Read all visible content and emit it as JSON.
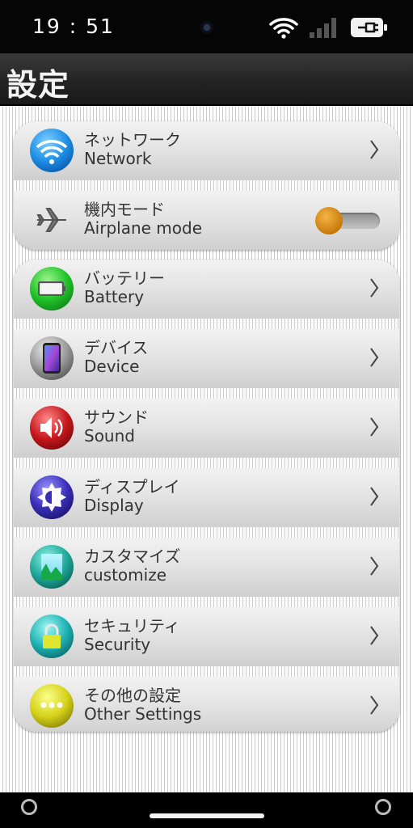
{
  "status_bar": {
    "time": "19 : 51",
    "icons": [
      "wifi-icon",
      "signal-icon",
      "battery-charging-icon"
    ]
  },
  "header": {
    "title": "設定"
  },
  "settings": {
    "network": {
      "ja": "ネットワーク",
      "en": "Network",
      "icon": "wifi-icon",
      "color": "#1e8fe6"
    },
    "airplane": {
      "ja": "機内モード",
      "en": "Airplane mode",
      "icon": "airplane-icon",
      "toggle_on": false,
      "accent": "#e09a20"
    },
    "battery": {
      "ja": "バッテリー",
      "en": "Battery",
      "icon": "battery-icon",
      "color": "#22c22a"
    },
    "device": {
      "ja": "デバイス",
      "en": "Device",
      "icon": "phone-icon",
      "color": "#9a9a9a"
    },
    "sound": {
      "ja": "サウンド",
      "en": "Sound",
      "icon": "speaker-icon",
      "color": "#c8181c"
    },
    "display": {
      "ja": "ディスプレイ",
      "en": "Display",
      "icon": "brightness-icon",
      "color": "#3a2fb8"
    },
    "customize": {
      "ja": "カスタマイズ",
      "en": "customize",
      "icon": "wallpaper-icon",
      "color": "#1fa89a"
    },
    "security": {
      "ja": "セキュリティ",
      "en": "Security",
      "icon": "lock-icon",
      "color": "#1fb3b3"
    },
    "other": {
      "ja": "その他の設定",
      "en": "Other Settings",
      "icon": "more-icon",
      "color": "#d6d21a"
    }
  },
  "navigation": [
    "back-button",
    "home-bar",
    "recents-button"
  ]
}
